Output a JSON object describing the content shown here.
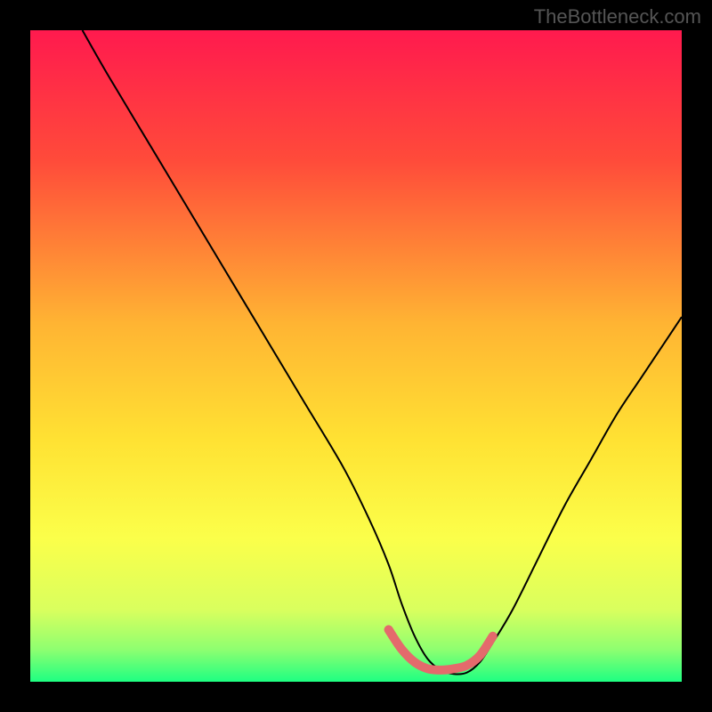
{
  "watermark": "TheBottleneck.com",
  "chart_data": {
    "type": "line",
    "title": "",
    "xlabel": "",
    "ylabel": "",
    "xlim": [
      0,
      100
    ],
    "ylim": [
      0,
      100
    ],
    "gradient_stops": [
      {
        "offset": 0,
        "color": "#ff1a4e"
      },
      {
        "offset": 20,
        "color": "#ff4b3a"
      },
      {
        "offset": 45,
        "color": "#ffb433"
      },
      {
        "offset": 63,
        "color": "#ffe233"
      },
      {
        "offset": 78,
        "color": "#fbff4a"
      },
      {
        "offset": 89,
        "color": "#d9ff5e"
      },
      {
        "offset": 95,
        "color": "#8fff70"
      },
      {
        "offset": 100,
        "color": "#1eff82"
      }
    ],
    "series": [
      {
        "name": "bottleneck-curve",
        "color": "#000000",
        "stroke_width": 2,
        "x": [
          8,
          12,
          18,
          24,
          30,
          36,
          42,
          48,
          52,
          55,
          57,
          59,
          61,
          63,
          65,
          67,
          69,
          71,
          74,
          78,
          82,
          86,
          90,
          94,
          98,
          100
        ],
        "y": [
          100,
          93,
          83,
          73,
          63,
          53,
          43,
          33,
          25,
          18,
          12,
          7,
          3.5,
          1.8,
          1.2,
          1.4,
          3,
          6,
          11,
          19,
          27,
          34,
          41,
          47,
          53,
          56
        ]
      }
    ],
    "highlight": {
      "name": "optimal-range",
      "color": "#e46a6c",
      "stroke_width": 10,
      "x": [
        55,
        57,
        59,
        61,
        63,
        65,
        67,
        69,
        71
      ],
      "y": [
        8,
        5,
        3,
        2,
        1.8,
        2,
        2.5,
        4,
        7
      ]
    }
  }
}
